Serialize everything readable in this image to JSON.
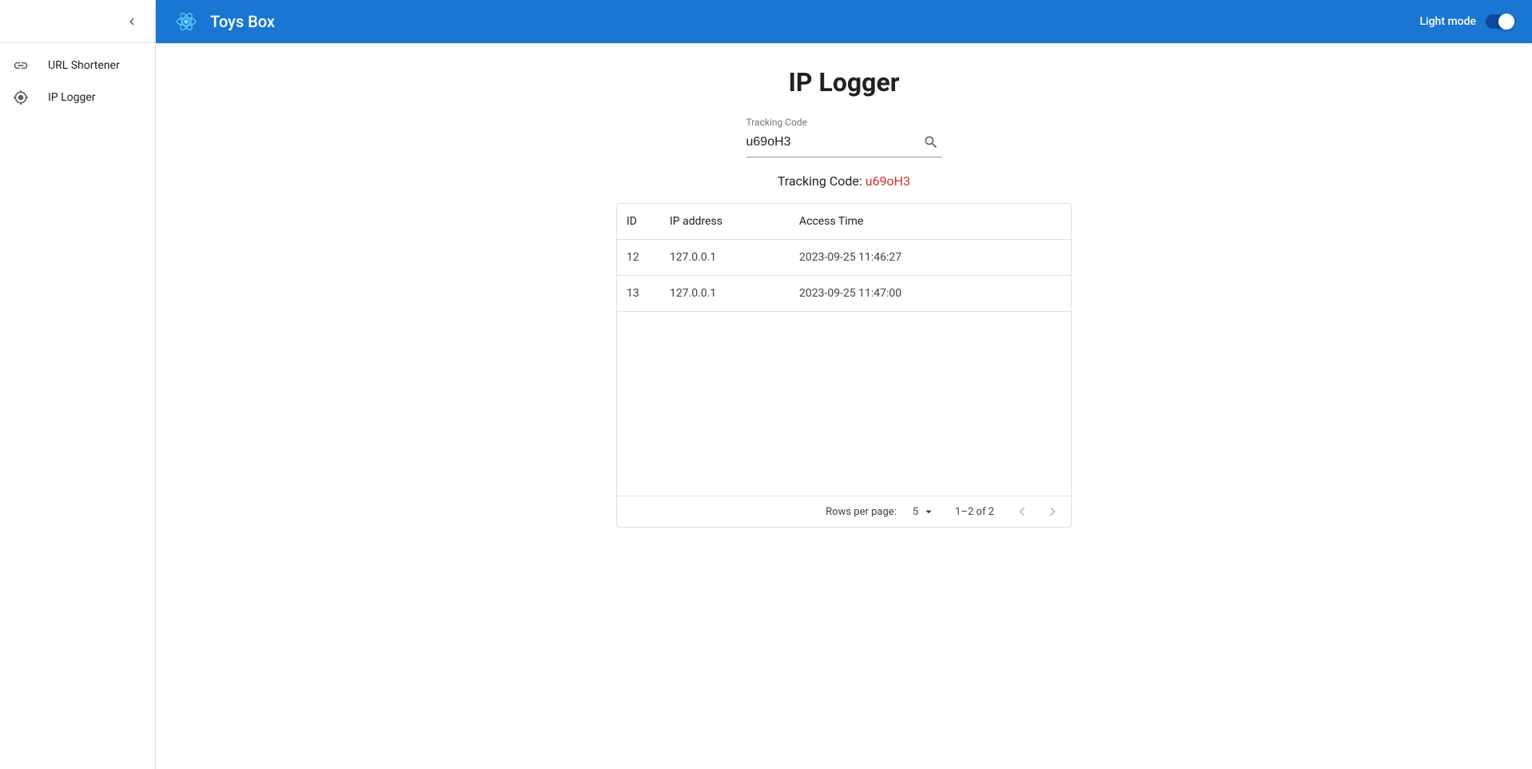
{
  "header": {
    "app_title": "Toys Box",
    "mode_label": "Light mode"
  },
  "sidebar": {
    "items": [
      {
        "label": "URL Shortener",
        "icon": "link-icon"
      },
      {
        "label": "IP Logger",
        "icon": "track-icon"
      }
    ]
  },
  "main": {
    "page_title": "IP Logger",
    "search": {
      "label": "Tracking Code",
      "value": "u69oH3"
    },
    "tracking_display": {
      "label": "Tracking Code:",
      "value": "u69oH3"
    },
    "table": {
      "columns": [
        {
          "label": "ID"
        },
        {
          "label": "IP address"
        },
        {
          "label": "Access Time"
        }
      ],
      "rows": [
        {
          "id": "12",
          "ip": "127.0.0.1",
          "time": "2023-09-25 11:46:27"
        },
        {
          "id": "13",
          "ip": "127.0.0.1",
          "time": "2023-09-25 11:47:00"
        }
      ]
    },
    "pagination": {
      "rows_label": "Rows per page:",
      "rows_value": "5",
      "range": "1–2 of 2"
    }
  }
}
